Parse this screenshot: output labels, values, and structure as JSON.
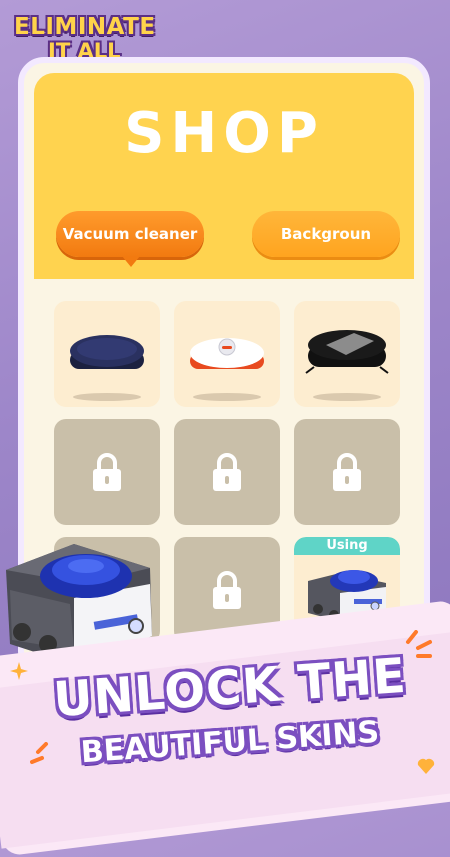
{
  "logo": {
    "line1": "ELIMINATE",
    "line2": "IT ALL"
  },
  "shop": {
    "title": "SHOP",
    "tabs": [
      {
        "label": "Vacuum cleaner",
        "active": true
      },
      {
        "label": "Backgroun",
        "active": false
      }
    ]
  },
  "grid": {
    "items": [
      {
        "state": "unlocked",
        "skin": "dark-navy-robot"
      },
      {
        "state": "unlocked",
        "skin": "white-red-robot"
      },
      {
        "state": "unlocked",
        "skin": "black-mesh-robot"
      },
      {
        "state": "locked",
        "icon": "lock-icon"
      },
      {
        "state": "locked",
        "icon": "lock-icon"
      },
      {
        "state": "locked",
        "icon": "lock-icon"
      },
      {
        "state": "locked",
        "icon": "lock-icon"
      },
      {
        "state": "locked",
        "icon": "lock-icon"
      },
      {
        "state": "using",
        "skin": "blue-dome-robot",
        "badge": "Using"
      }
    ]
  },
  "promo": {
    "line1": "UNLOCK THE",
    "line2": "BEAUTIFUL SKINS"
  },
  "colors": {
    "header": "#ffd34f",
    "tab_active": "#f27a10",
    "tab_inactive": "#ffa41f",
    "using_badge": "#5fd4c7",
    "locked_tile": "#c9bfa9",
    "accent_text": "#7b4fc0"
  }
}
